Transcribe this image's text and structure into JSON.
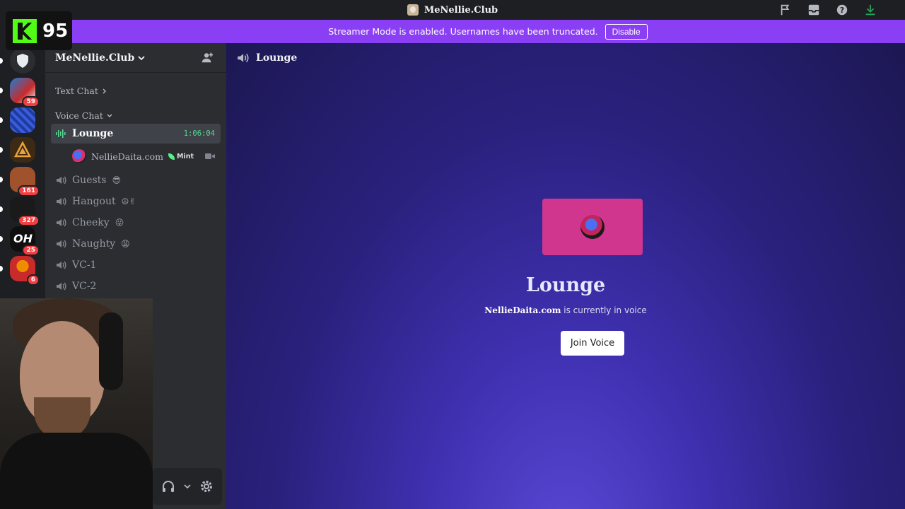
{
  "titlebar": {
    "title": "MeNellie.Club"
  },
  "banner": {
    "message": "Streamer Mode is enabled. Usernames have been truncated.",
    "button": "Disable",
    "color": "#8b3ff5"
  },
  "overlay": {
    "viewer_count": "95"
  },
  "servers": [
    {
      "name": "shield-server",
      "badge": ""
    },
    {
      "name": "santa-server",
      "badge": "59"
    },
    {
      "name": "blue-server",
      "badge": ""
    },
    {
      "name": "gold-server",
      "badge": ""
    },
    {
      "name": "orange-server",
      "badge": "161"
    },
    {
      "name": "sign-server",
      "badge": "327"
    },
    {
      "name": "oh-server",
      "badge": "25"
    },
    {
      "name": "red-server",
      "badge": "6"
    }
  ],
  "sidebar": {
    "server_name": "MeNellie.Club",
    "categories": {
      "text": "Text Chat",
      "voice": "Voice Chat"
    },
    "active_channel": {
      "name": "Lounge",
      "timer": "1:06:04"
    },
    "voice_user": {
      "name": "NellieDaita.com",
      "tag": "Mint"
    },
    "channels": [
      {
        "name": "Guests",
        "emoji": "😎"
      },
      {
        "name": "Hangout",
        "emoji": "☮✌"
      },
      {
        "name": "Cheeky",
        "emoji": "😜"
      },
      {
        "name": "Naughty",
        "emoji": "😩"
      },
      {
        "name": "VC-1",
        "emoji": ""
      },
      {
        "name": "VC-2",
        "emoji": ""
      }
    ]
  },
  "main": {
    "channel": "Lounge",
    "status_user": "NellieDaita.com",
    "status_suffix": " is currently in voice",
    "join_button": "Join Voice",
    "card_color": "#d1368e"
  }
}
